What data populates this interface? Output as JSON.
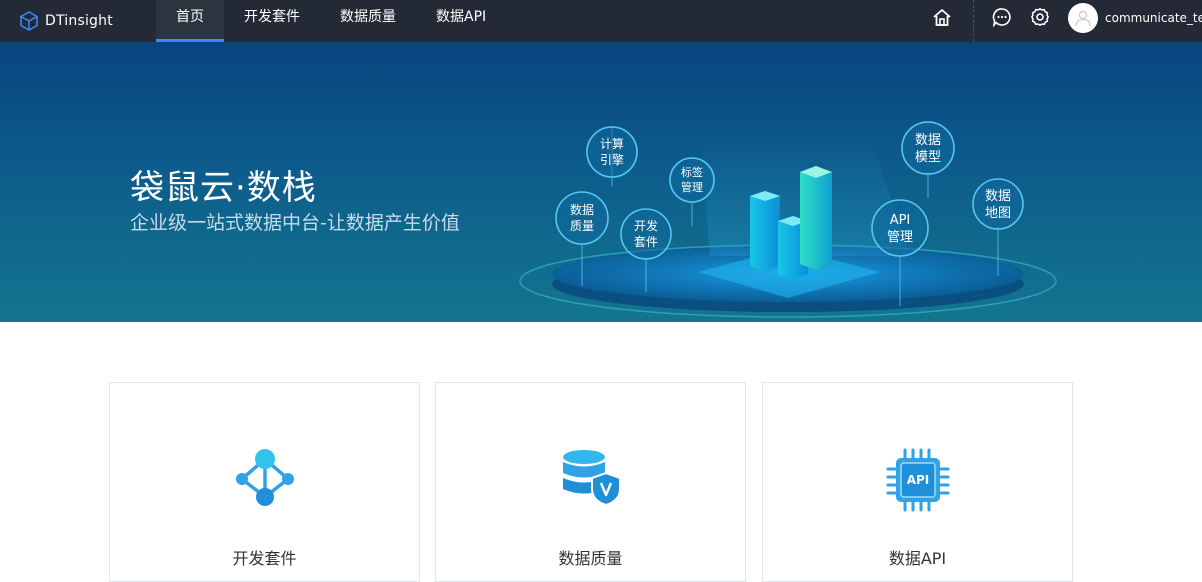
{
  "brand": {
    "name": "DTinsight"
  },
  "nav": {
    "tabs": [
      {
        "label": "首页",
        "active": true
      },
      {
        "label": "开发套件",
        "active": false
      },
      {
        "label": "数据质量",
        "active": false
      },
      {
        "label": "数据API",
        "active": false
      }
    ],
    "user": {
      "name": "communicate_test"
    },
    "icons": [
      "home-icon",
      "message-icon",
      "gear-icon"
    ]
  },
  "banner": {
    "title": "袋鼠云·数栈",
    "subtitle": "企业级一站式数据中台-让数据产生价值",
    "bubbles": [
      {
        "line1": "计算",
        "line2": "引擎"
      },
      {
        "line1": "数据",
        "line2": "质量"
      },
      {
        "line1": "标签",
        "line2": "管理"
      },
      {
        "line1": "开发",
        "line2": "套件"
      },
      {
        "line1": "数据",
        "line2": "模型"
      },
      {
        "line1": "API",
        "line2": "管理"
      },
      {
        "line1": "数据",
        "line2": "地图"
      }
    ]
  },
  "cards": [
    {
      "label": "开发套件",
      "icon": "network-nodes-icon"
    },
    {
      "label": "数据质量",
      "icon": "database-shield-icon"
    },
    {
      "label": "数据API",
      "icon": "api-chip-icon"
    }
  ],
  "colors": {
    "nav_bg": "#232a36",
    "accent": "#3f87ff",
    "icon_blue": "#2fa3e6"
  }
}
